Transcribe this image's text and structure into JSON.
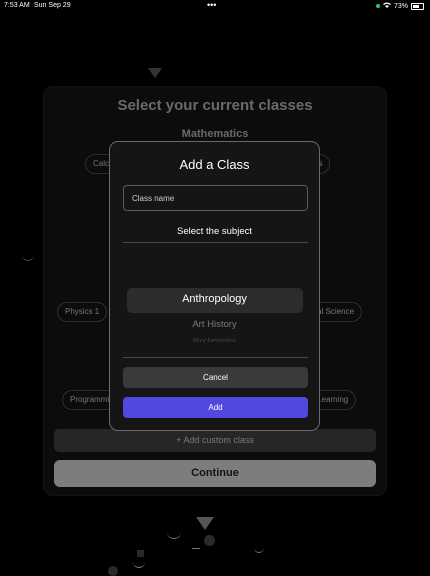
{
  "status_bar": {
    "time": "7:53 AM",
    "date": "Sun Sep 29",
    "dots": "•••",
    "battery": "73%",
    "wifi_icon": "wifi-icon"
  },
  "background": {
    "title": "Select your current classes",
    "subject_heading": "Mathematics",
    "chips": {
      "calculus": "Calc",
      "math_right": "atics",
      "physics": "Physics 1",
      "environmental": "ental Science",
      "programming": "Programmi",
      "machine_learning": "ne Learning"
    },
    "add_custom_label": "+ Add custom class",
    "continue_label": "Continue"
  },
  "modal": {
    "title": "Add a Class",
    "class_name_placeholder": "Class name",
    "class_name_value": "",
    "subject_label": "Select the subject",
    "picker": {
      "selected": "Anthropology",
      "next": "Art History",
      "next2": "Biochemistry"
    },
    "cancel_label": "Cancel",
    "add_label": "Add"
  },
  "colors": {
    "accent": "#5148e0",
    "background": "#000000",
    "modal_bg": "#151515"
  }
}
